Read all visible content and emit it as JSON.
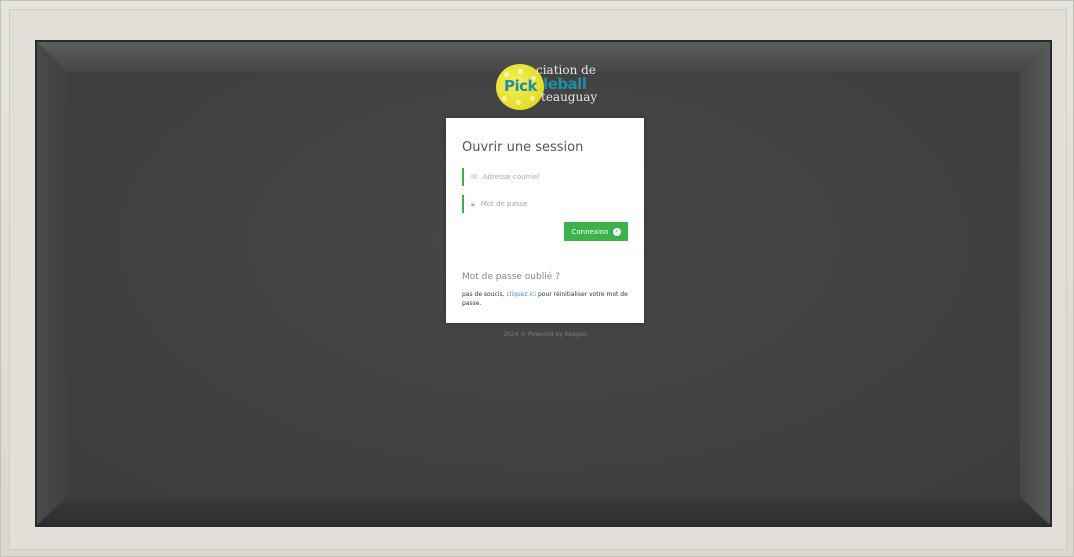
{
  "logo": {
    "text_pick": "Pick",
    "text_leball": "leball",
    "text_top": "ciation de",
    "text_bottom": "teauguay"
  },
  "login": {
    "title": "Ouvrir une session",
    "email_placeholder": "Adresse courriel",
    "password_placeholder": "Mot de passe",
    "submit_label": "Connexion",
    "forgot_title": "Mot de passe oublié ?",
    "forgot_prefix": "pas de soucis, ",
    "forgot_link": "cliquez ici",
    "forgot_suffix": " pour réinitialiser votre mot de passe."
  },
  "footer": {
    "text": "2024 © Powered by Keegan"
  },
  "colors": {
    "accent": "#3cb34a",
    "link": "#3a8fd6",
    "logo_ball": "#e2dd2a",
    "logo_text": "#1e8fa8",
    "background": "#414141"
  },
  "icons": {
    "email": "envelope-icon",
    "password": "lock-icon",
    "submit": "arrow-circle-right-icon"
  }
}
